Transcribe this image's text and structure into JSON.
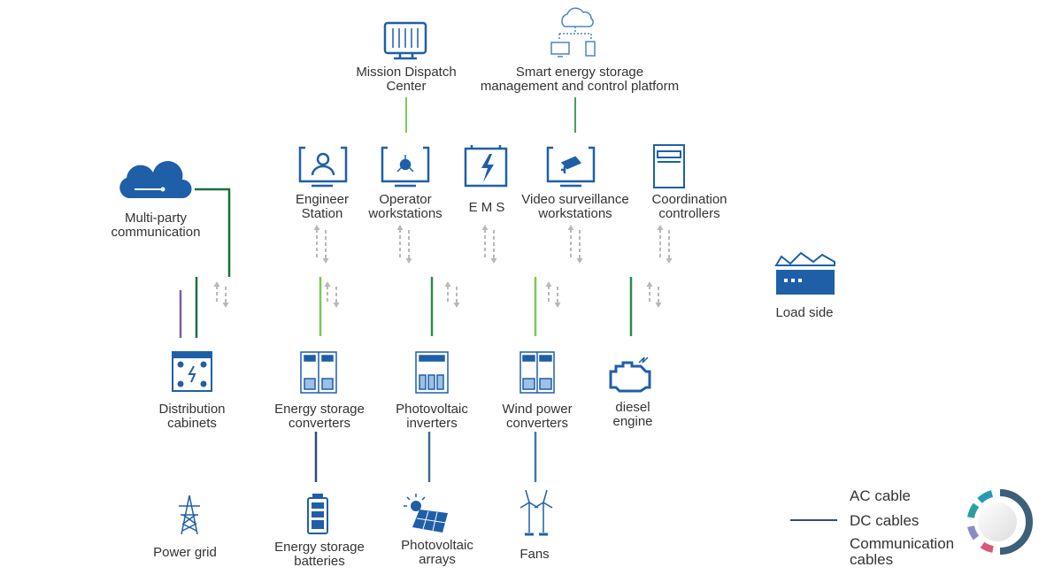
{
  "top_nodes": [
    {
      "label": "Mission Dispatch\nCenter",
      "icon": "control-panel-monitor-icon"
    },
    {
      "label": "Smart energy storage\nmanagement and control platform",
      "icon": "cloud-devices-icon"
    }
  ],
  "stations": [
    {
      "label": "Engineer\nStation",
      "icon": "user-monitor-icon"
    },
    {
      "label": "Operator\nworkstations",
      "icon": "network-monitor-icon"
    },
    {
      "label": "E M S",
      "icon": "battery-bolt-icon"
    },
    {
      "label": "Video surveillance\nworkstations",
      "icon": "camera-monitor-icon"
    },
    {
      "label": "Coordination\ncontrollers",
      "icon": "cabinet-icon"
    }
  ],
  "cloud": {
    "label": "Multi-party\ncommunication",
    "icon": "cloud-icon"
  },
  "load": {
    "label": "Load side",
    "icon": "factory-icon"
  },
  "devices": [
    {
      "label": "Distribution\ncabinets",
      "icon": "distribution-cabinet-icon"
    },
    {
      "label": "Energy storage\nconverters",
      "icon": "converter-icon"
    },
    {
      "label": "Photovoltaic\ninverters",
      "icon": "inverter-icon"
    },
    {
      "label": "Wind power\nconverters",
      "icon": "wind-converter-icon"
    },
    {
      "label": "diesel\nengine",
      "icon": "engine-icon"
    }
  ],
  "sources": [
    {
      "label": "Power grid",
      "icon": "power-tower-icon"
    },
    {
      "label": "Energy storage\nbatteries",
      "icon": "battery-icon"
    },
    {
      "label": "Photovoltaic\narrays",
      "icon": "solar-panel-icon"
    },
    {
      "label": "Fans",
      "icon": "wind-turbine-icon"
    }
  ],
  "legend": [
    {
      "label": "AC cable",
      "colors": [
        "#7b5ea7",
        "#f0b030"
      ]
    },
    {
      "label": "DC cables",
      "colors": [
        "#2f4d7a",
        "#2f4d7a"
      ]
    },
    {
      "label": "Communication\ncables",
      "colors": [
        "#1e6e3a",
        "#7ec8d8"
      ]
    }
  ],
  "colors": {
    "icon": "#1f5fa8",
    "text": "#333333",
    "arrow": "#b8b8b8",
    "comm": "#2f8a4a",
    "ac": "#f0b030",
    "dc": "#2f4d7a"
  }
}
